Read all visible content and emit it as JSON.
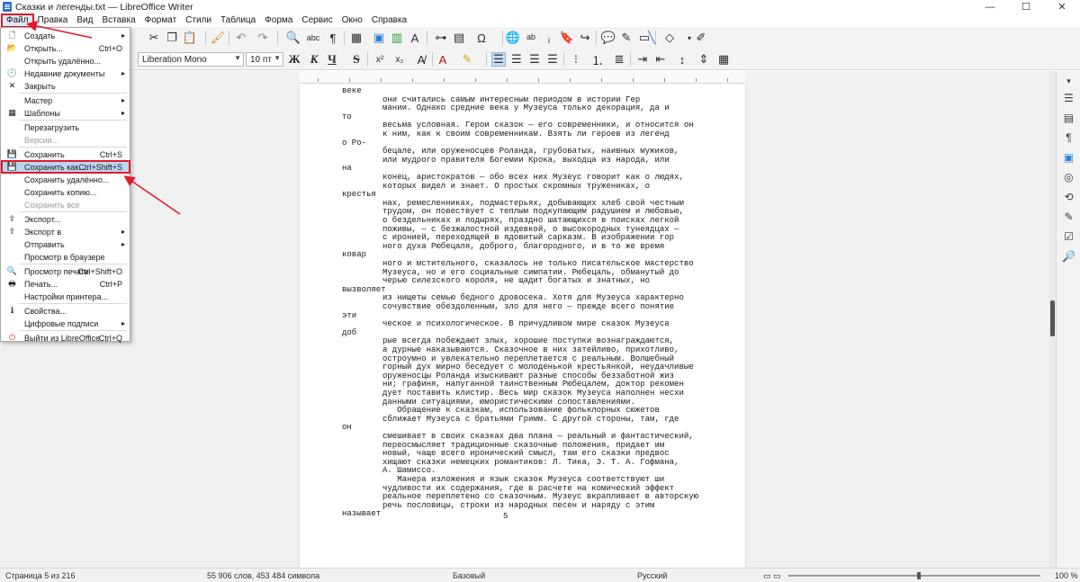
{
  "window": {
    "title": "Сказки и легенды.txt — LibreOffice Writer",
    "minimize": "—",
    "maximize": "☐",
    "close": "✕"
  },
  "menubar": [
    "Файл",
    "Правка",
    "Вид",
    "Вставка",
    "Формат",
    "Стили",
    "Таблица",
    "Форма",
    "Сервис",
    "Окно",
    "Справка"
  ],
  "toolbar": {
    "font_name": "Liberation Mono",
    "font_size": "10 пт"
  },
  "file_menu": {
    "items": [
      {
        "label": "Создать",
        "icon": "new-doc-icon",
        "submenu": true
      },
      {
        "label": "Открыть...",
        "shortcut": "Ctrl+O",
        "icon": "open-folder-icon"
      },
      {
        "label": "Открыть удалённо..."
      },
      {
        "label": "Недавние документы",
        "icon": "recent-docs-icon",
        "submenu": true
      },
      {
        "label": "Закрыть",
        "icon": "close-doc-icon"
      },
      {
        "label": "Мастер",
        "submenu": true
      },
      {
        "label": "Шаблоны",
        "icon": "templates-icon",
        "submenu": true
      },
      {
        "label": "Перезагрузить"
      },
      {
        "label": "Версии...",
        "disabled": true
      },
      {
        "label": "Сохранить",
        "shortcut": "Ctrl+S",
        "icon": "save-icon"
      },
      {
        "label": "Сохранить как...",
        "shortcut": "Ctrl+Shift+S",
        "icon": "save-as-icon",
        "highlighted": true
      },
      {
        "label": "Сохранить удалённо..."
      },
      {
        "label": "Сохранить копию..."
      },
      {
        "label": "Сохранить все",
        "disabled": true
      },
      {
        "label": "Экспорт...",
        "icon": "export-icon"
      },
      {
        "label": "Экспорт в",
        "icon": "export-to-icon",
        "submenu": true
      },
      {
        "label": "Отправить",
        "submenu": true
      },
      {
        "label": "Просмотр в браузере"
      },
      {
        "label": "Просмотр печати",
        "shortcut": "Ctrl+Shift+O",
        "icon": "print-preview-icon"
      },
      {
        "label": "Печать...",
        "shortcut": "Ctrl+P",
        "icon": "print-icon"
      },
      {
        "label": "Настройки принтера..."
      },
      {
        "label": "Свойства...",
        "icon": "properties-icon"
      },
      {
        "label": "Цифровые подписи",
        "submenu": true
      },
      {
        "label": "Выйти из LibreOffice",
        "shortcut": "Ctrl+Q",
        "icon": "exit-icon"
      }
    ]
  },
  "document": {
    "lines": [
      {
        "margin": "веке",
        "text": ""
      },
      {
        "margin": "",
        "text": "они считались самым интересным периодом в истории Гер"
      },
      {
        "margin": "",
        "text": "мании. Однако средние века у Музеуса только декорация, да и"
      },
      {
        "margin": "то",
        "text": ""
      },
      {
        "margin": "",
        "text": "весьма условная. Герои сказок — его современники, и относится он"
      },
      {
        "margin": "",
        "text": "к ним, как к своим современникам. Взять ли героев из легенд"
      },
      {
        "margin": "о Ро-",
        "text": ""
      },
      {
        "margin": "",
        "text": "бецале, или оруженосцев Роланда, грубоватых, наивных мужиков,"
      },
      {
        "margin": "",
        "text": "или мудрого правителя Богемии Крока, выходца из народа, или"
      },
      {
        "margin": "на",
        "text": ""
      },
      {
        "margin": "",
        "text": "конец, аристократов — обо всех них Музеус говорит как о людях,"
      },
      {
        "margin": "",
        "text": "которых видел и знает. О простых скромных тружениках, о"
      },
      {
        "margin": "крестья",
        "text": ""
      },
      {
        "margin": "",
        "text": "нах, ремесленниках, подмастерьях, добывающих хлеб свой честным"
      },
      {
        "margin": "",
        "text": "трудом, он повествует с теплым подкупающим радушием и любовью,"
      },
      {
        "margin": "",
        "text": "о бездельниках и лодырях, праздно шатающихся в поисках легкой"
      },
      {
        "margin": "",
        "text": "поживы, — с безжалостной издевкой, о высокородных тунеядцах —"
      },
      {
        "margin": "",
        "text": "с иронией, переходящей в ядовитый сарказм. В изображении гор"
      },
      {
        "margin": "",
        "text": "ного духа Рюбецаля, доброго, благородного, и в то же время"
      },
      {
        "margin": "ковар",
        "text": ""
      },
      {
        "margin": "",
        "text": "ного и мстительного, сказалось не только писательское мастерство"
      },
      {
        "margin": "",
        "text": "Музеуса, но и его социальные симпатии. Рюбецаль, обманутый до"
      },
      {
        "margin": "",
        "text": "черью силезского короля, не щадит богатых и знатных, но"
      },
      {
        "margin": "вызволяет",
        "text": ""
      },
      {
        "margin": "",
        "text": "из нищеты семью бедного дровосека. Хотя для Музеуса характерно"
      },
      {
        "margin": "",
        "text": "сочувствие обездоленным, зло для него — прежде всего понятие"
      },
      {
        "margin": "эти",
        "text": ""
      },
      {
        "margin": "",
        "text": "ческое и психологическое. В причудливом мире сказок Музеуса"
      },
      {
        "margin": "доб",
        "text": ""
      },
      {
        "margin": "",
        "text": "рые всегда побеждают злых, хорошие поступки вознаграждаются,"
      },
      {
        "margin": "",
        "text": "а дурные наказываются. Сказочное в них затейливо, прихотливо,"
      },
      {
        "margin": "",
        "text": "остроумно и увлекательно переплетается с реальным. Волшебный"
      },
      {
        "margin": "",
        "text": "горный дух мирно беседует с молоденькой крестьянкой, неудачливые"
      },
      {
        "margin": "",
        "text": "оруженосцы Роланда изыскивают разные способы беззаботной жиз"
      },
      {
        "margin": "",
        "text": "ни; графиня, напуганной таинственным Рюбецалем, доктор рекомен"
      },
      {
        "margin": "",
        "text": "дует поставить клистир. Весь мир сказок Музеуса наполнен несхи"
      },
      {
        "margin": "",
        "text": "данными ситуациями, юмористическими сопоставлениями."
      },
      {
        "margin": "",
        "text": "   Обращение к сказкам, использование фольклорных сюжетов"
      },
      {
        "margin": "",
        "text": "сближает Музеуса с братьями Гримм. С другой стороны, там, где"
      },
      {
        "margin": "он",
        "text": ""
      },
      {
        "margin": "",
        "text": "смешивает в своих сказках два плана — реальный и фантастический,"
      },
      {
        "margin": "",
        "text": "переосмысляет традиционные сказочные положения, придает им"
      },
      {
        "margin": "",
        "text": "новый, чаще всего иронический смысл, там его сказки предвос"
      },
      {
        "margin": "",
        "text": "хищают сказки немецких романтиков: Л. Тика, Э. Т. А. Гофмана,"
      },
      {
        "margin": "",
        "text": "А. Шамиссо."
      },
      {
        "margin": "",
        "text": "   Манера изложения и язык сказок Музеуса соответствуют ши"
      },
      {
        "margin": "",
        "text": "чудливости их содержания, где в расчете на комический эффект"
      },
      {
        "margin": "",
        "text": "реальное переплетено со сказочным. Музеус вкрапливает в авторскую"
      },
      {
        "margin": "",
        "text": "речь пословицы, строки из народных песен и наряду с этим"
      },
      {
        "margin": "называет",
        "text": ""
      }
    ],
    "page_number": "5"
  },
  "statusbar": {
    "page": "Страница 5 из 216",
    "words": "55 906 слов, 453 484 символа",
    "style": "Базовый",
    "language": "Русский",
    "zoom": "100 %"
  }
}
